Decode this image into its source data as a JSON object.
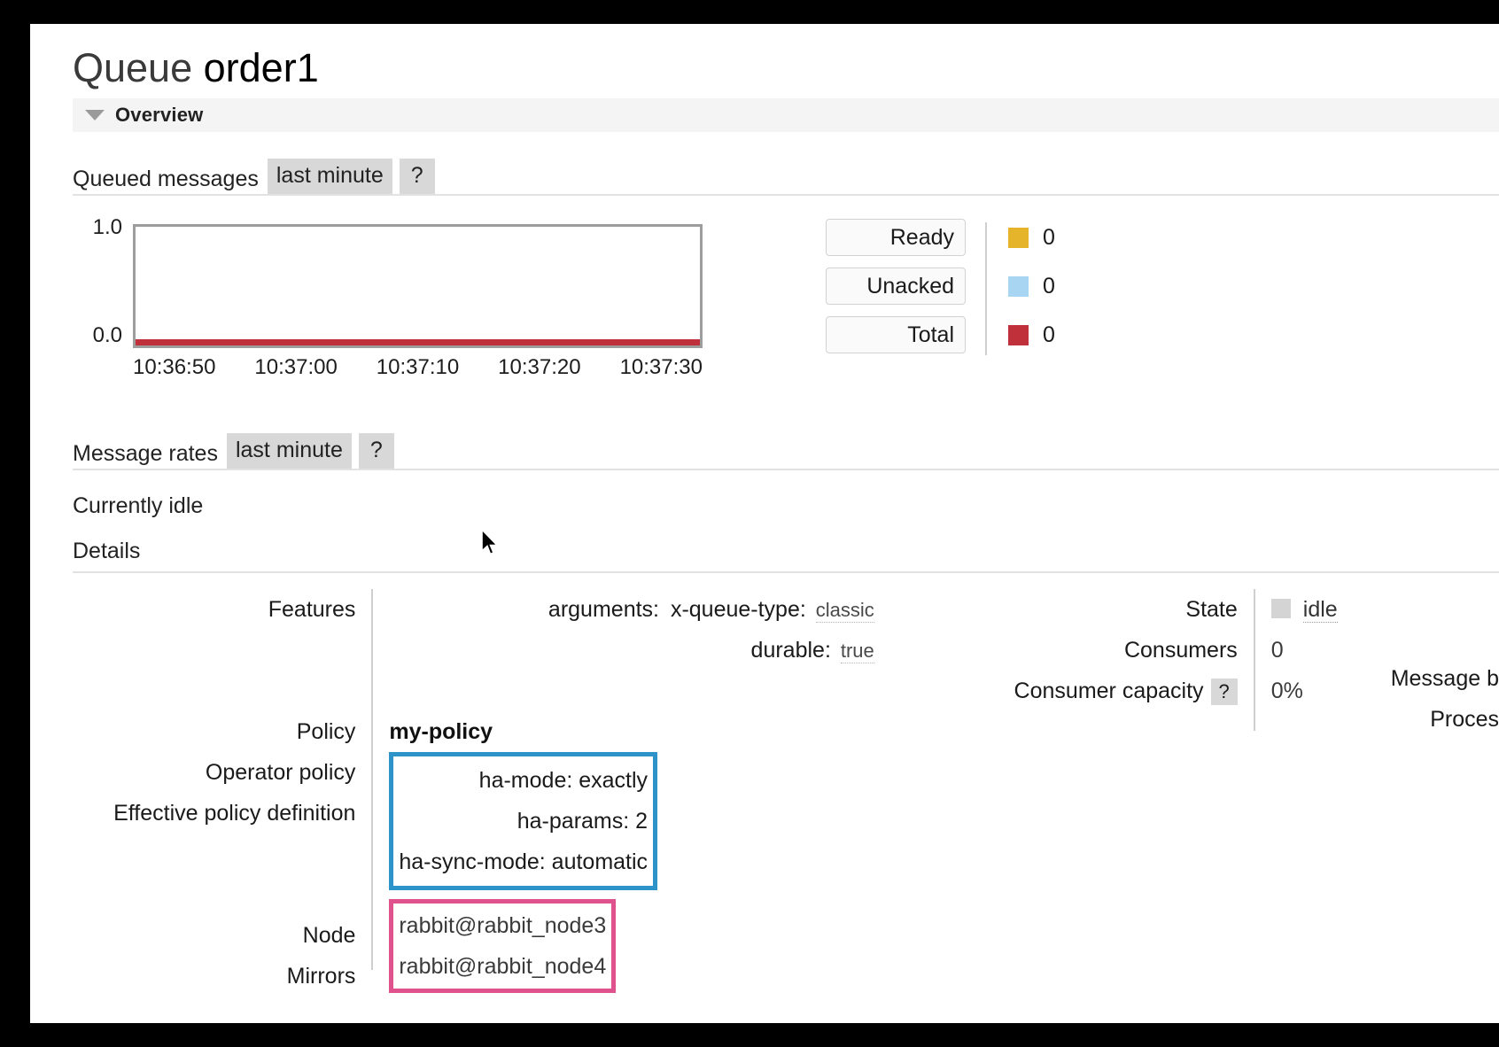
{
  "page": {
    "title_prefix": "Queue",
    "title_name": "order1"
  },
  "overview_section": {
    "label": "Overview",
    "caret_icon": "caret-down-icon"
  },
  "queued_messages": {
    "title": "Queued messages",
    "period": "last minute",
    "help": "?"
  },
  "message_rates": {
    "title": "Message rates",
    "period": "last minute",
    "help": "?",
    "status": "Currently idle"
  },
  "details": {
    "heading": "Details",
    "labels": {
      "features": "Features",
      "policy": "Policy",
      "operator_policy": "Operator policy",
      "effective_policy_definition": "Effective policy definition",
      "node": "Node",
      "mirrors": "Mirrors",
      "state": "State",
      "consumers": "Consumers",
      "consumer_capacity": "Consumer capacity",
      "consumer_capacity_help": "?"
    },
    "features": [
      {
        "key": "arguments:",
        "sub_key": "x-queue-type:",
        "value": "classic"
      },
      {
        "key": "durable:",
        "value": "true"
      }
    ],
    "policy_value": "my-policy",
    "operator_policy_value": "",
    "effective_policy_definition": [
      {
        "key": "ha-mode:",
        "value": "exactly"
      },
      {
        "key": "ha-params:",
        "value": "2"
      },
      {
        "key": "ha-sync-mode:",
        "value": "automatic"
      }
    ],
    "node_value": "rabbit@rabbit_node3",
    "mirrors_value": "rabbit@rabbit_node4",
    "state_value": "idle",
    "consumers_value": "0",
    "consumer_capacity_value": "0%",
    "clipped_right": {
      "message_bytes": "Message b",
      "process": "Proces"
    }
  },
  "colors": {
    "ready": "#e5b42b",
    "unacked": "#a8d5f2",
    "total": "#c0303a",
    "highlight_blue": "#2e93c8",
    "highlight_pink": "#e0528e"
  },
  "chart_data": {
    "type": "line",
    "title": "Queued messages",
    "xlabel": "",
    "ylabel": "",
    "ylim": [
      0.0,
      1.0
    ],
    "ytick_labels": [
      "1.0",
      "0.0"
    ],
    "x": [
      "10:36:50",
      "10:37:00",
      "10:37:10",
      "10:37:20",
      "10:37:30"
    ],
    "grid": false,
    "legend_position": "right",
    "series": [
      {
        "name": "Ready",
        "color": "#e5b42b",
        "current": "0",
        "values": [
          0,
          0,
          0,
          0,
          0
        ]
      },
      {
        "name": "Unacked",
        "color": "#a8d5f2",
        "current": "0",
        "values": [
          0,
          0,
          0,
          0,
          0
        ]
      },
      {
        "name": "Total",
        "color": "#c0303a",
        "current": "0",
        "values": [
          0,
          0,
          0,
          0,
          0
        ]
      }
    ]
  }
}
